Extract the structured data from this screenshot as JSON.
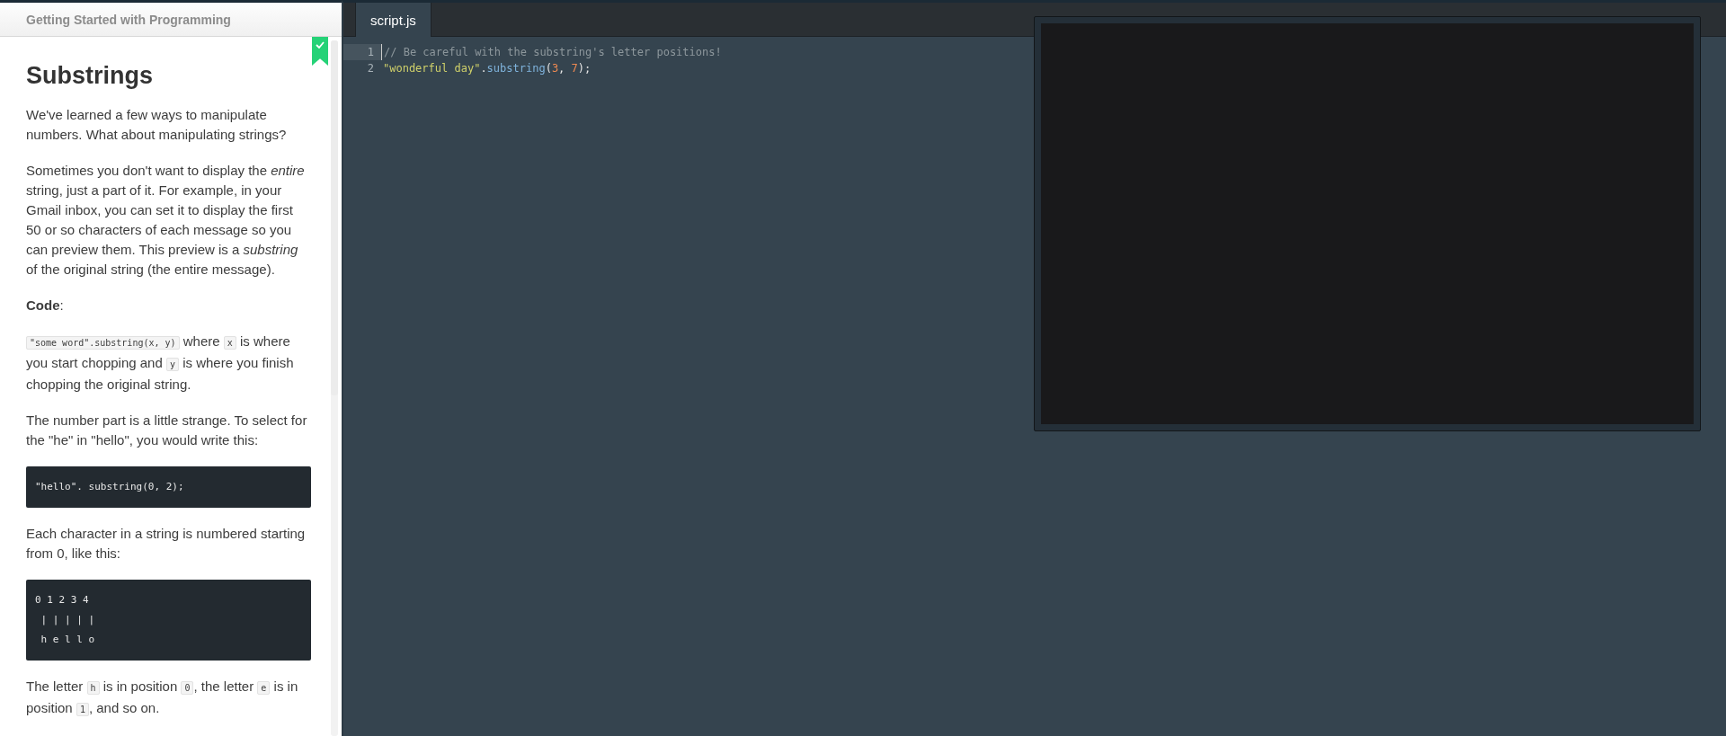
{
  "header": {
    "title": "Getting Started with Programming"
  },
  "lesson": {
    "completed": true,
    "title": "Substrings",
    "blocks": [
      {
        "kind": "paragraph",
        "parts": [
          {
            "kind": "text",
            "text": "We've learned a few ways to manipulate numbers. What about manipulating strings?"
          }
        ]
      },
      {
        "kind": "paragraph",
        "parts": [
          {
            "kind": "text",
            "text": "Sometimes you don't want to display the *entire* string, just a part of it. For example, in your Gmail inbox, you can set it to display the first 50 or so characters of each message so you can preview them. This preview is a *substring* of the original string (the entire message)."
          }
        ]
      },
      {
        "kind": "paragraph",
        "parts": [
          {
            "kind": "text",
            "text": "**Code**:"
          }
        ]
      },
      {
        "kind": "paragraph",
        "parts": [
          {
            "kind": "code",
            "text": "\"some word\".substring(x, y)"
          },
          {
            "kind": "text",
            "text": " where "
          },
          {
            "kind": "code",
            "text": "x"
          },
          {
            "kind": "text",
            "text": " is where you start chopping and "
          },
          {
            "kind": "code",
            "text": "y"
          },
          {
            "kind": "text",
            "text": " is where you finish chopping the original string."
          }
        ]
      },
      {
        "kind": "paragraph",
        "parts": [
          {
            "kind": "text",
            "text": "The number part is a little strange. To select for the \"he\" in \"hello\", you would write this:"
          }
        ]
      },
      {
        "kind": "codeblock",
        "lines": [
          "\"hello\". substring(0, 2);"
        ]
      },
      {
        "kind": "paragraph",
        "parts": [
          {
            "kind": "text",
            "text": "Each character in a string is numbered starting from 0, like this:"
          }
        ]
      },
      {
        "kind": "codeblock",
        "lines": [
          "0 1 2 3 4",
          " | | | | |",
          " h e l l o"
        ]
      },
      {
        "kind": "paragraph",
        "parts": [
          {
            "kind": "text",
            "text": "The letter "
          },
          {
            "kind": "code",
            "text": "h"
          },
          {
            "kind": "text",
            "text": " is in position "
          },
          {
            "kind": "code",
            "text": "0"
          },
          {
            "kind": "text",
            "text": ", the letter "
          },
          {
            "kind": "code",
            "text": "e"
          },
          {
            "kind": "text",
            "text": " is in position "
          },
          {
            "kind": "code",
            "text": "1"
          },
          {
            "kind": "text",
            "text": ", and so on."
          }
        ]
      }
    ]
  },
  "editor": {
    "tabs": [
      {
        "label": "script.js",
        "selected": true
      }
    ],
    "lines": [
      {
        "number": "1",
        "active": true,
        "tokens": [
          {
            "kind": "comment",
            "text": "// Be careful with the substring's letter positions!"
          }
        ]
      },
      {
        "number": "2",
        "active": false,
        "tokens": [
          {
            "kind": "string",
            "text": "\"wonderful day\""
          },
          {
            "kind": "punct",
            "text": "."
          },
          {
            "kind": "method",
            "text": "substring"
          },
          {
            "kind": "punct",
            "text": "("
          },
          {
            "kind": "number",
            "text": "3"
          },
          {
            "kind": "punct",
            "text": ", "
          },
          {
            "kind": "number",
            "text": "7"
          },
          {
            "kind": "punct",
            "text": ");"
          }
        ]
      }
    ]
  }
}
